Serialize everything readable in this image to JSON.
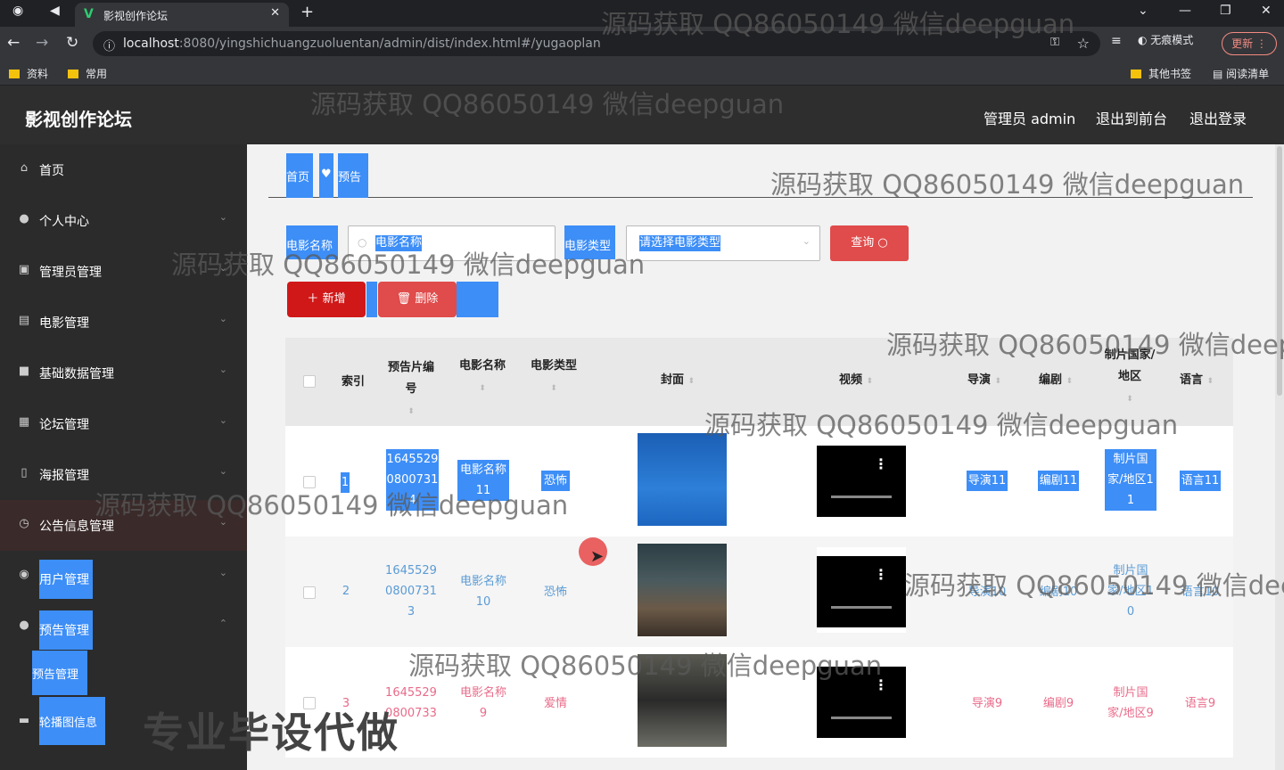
{
  "browser": {
    "tab_title": "影视创作论坛",
    "url_host": "localhost",
    "url_path": ":8080/yingshichuangzuoluentan/admin/dist/index.html#/yugaoplan",
    "bookmarks": [
      "资料",
      "常用"
    ],
    "bookmarks_right": [
      "其他书签",
      "阅读清单"
    ],
    "profile": "无痕模式",
    "update": "更新"
  },
  "header": {
    "title": "影视创作论坛",
    "user": "管理员 admin",
    "to_front": "退出到前台",
    "logout": "退出登录"
  },
  "sidebar": {
    "items": [
      {
        "label": "首页",
        "icon": "home-icon"
      },
      {
        "label": "个人中心",
        "icon": "user-icon"
      },
      {
        "label": "管理员管理",
        "icon": "admin-icon"
      },
      {
        "label": "电影管理",
        "icon": "film-icon"
      },
      {
        "label": "基础数据管理",
        "icon": "data-icon"
      },
      {
        "label": "论坛管理",
        "icon": "forum-icon"
      },
      {
        "label": "海报管理",
        "icon": "poster-icon"
      },
      {
        "label": "公告信息管理",
        "icon": "clock-icon"
      },
      {
        "label": "用户管理",
        "icon": "users-icon"
      },
      {
        "label": "预告管理",
        "icon": "trailer-icon"
      },
      {
        "label": "轮播图信息",
        "icon": "carousel-icon"
      }
    ],
    "sub_item": "预告管理"
  },
  "breadcrumb": {
    "home": "首页",
    "current": "预告"
  },
  "search": {
    "name_label": "电影名称",
    "name_placeholder": "电影名称",
    "type_label": "电影类型",
    "type_placeholder": "请选择电影类型",
    "query": "查询"
  },
  "actions": {
    "add": "新增",
    "delete": "删除"
  },
  "table": {
    "headers": {
      "index": "索引",
      "code": "预告片编号",
      "name": "电影名称",
      "type": "电影类型",
      "cover": "封面",
      "video": "视频",
      "director": "导演",
      "writer": "编剧",
      "country": "制片国家/地区",
      "language": "语言"
    },
    "rows": [
      {
        "index": "1",
        "code1": "1645529",
        "code2": "0800731",
        "code3": "4",
        "name1": "电影名称",
        "name2": "11",
        "type": "恐怖",
        "director": "导演11",
        "writer": "编剧11",
        "country1": "制片国",
        "country2": "家/地区1",
        "country3": "1",
        "language": "语言11"
      },
      {
        "index": "2",
        "code1": "1645529",
        "code2": "0800731",
        "code3": "3",
        "name1": "电影名称",
        "name2": "10",
        "type": "恐怖",
        "director": "导演10",
        "writer": "编剧10",
        "country1": "制片国",
        "country2": "家/地区1",
        "country3": "0",
        "language": "语言10"
      },
      {
        "index": "3",
        "code1": "1645529",
        "code2": "0800733",
        "code3": "",
        "name1": "电影名称",
        "name2": "9",
        "type": "爱情",
        "director": "导演9",
        "writer": "编剧9",
        "country1": "制片国",
        "country2": "家/地区9",
        "country3": "",
        "language": "语言9"
      }
    ]
  },
  "watermark": "源码获取 QQ86050149 微信deepguan",
  "promo": "专业毕设代做",
  "colors": {
    "accent": "#3d8ef7",
    "danger": "#e04b4b",
    "add": "#d01818",
    "link": "#5b9bd5",
    "pink": "#e96b8a"
  }
}
